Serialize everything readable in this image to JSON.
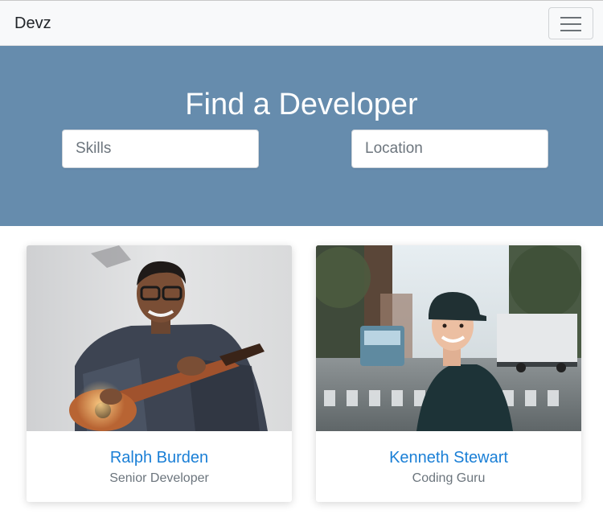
{
  "navbar": {
    "brand": "Devz",
    "menu_icon": "hamburger-menu-icon"
  },
  "hero": {
    "title": "Find a Developer",
    "skills_placeholder": "Skills",
    "location_placeholder": "Location"
  },
  "developers": [
    {
      "name": "Ralph Burden",
      "role": "Senior Developer"
    },
    {
      "name": "Kenneth Stewart",
      "role": "Coding Guru"
    }
  ],
  "colors": {
    "hero_background": "#668cad",
    "name_link": "#1a7fd6",
    "navbar_background": "#f8f9fa"
  }
}
